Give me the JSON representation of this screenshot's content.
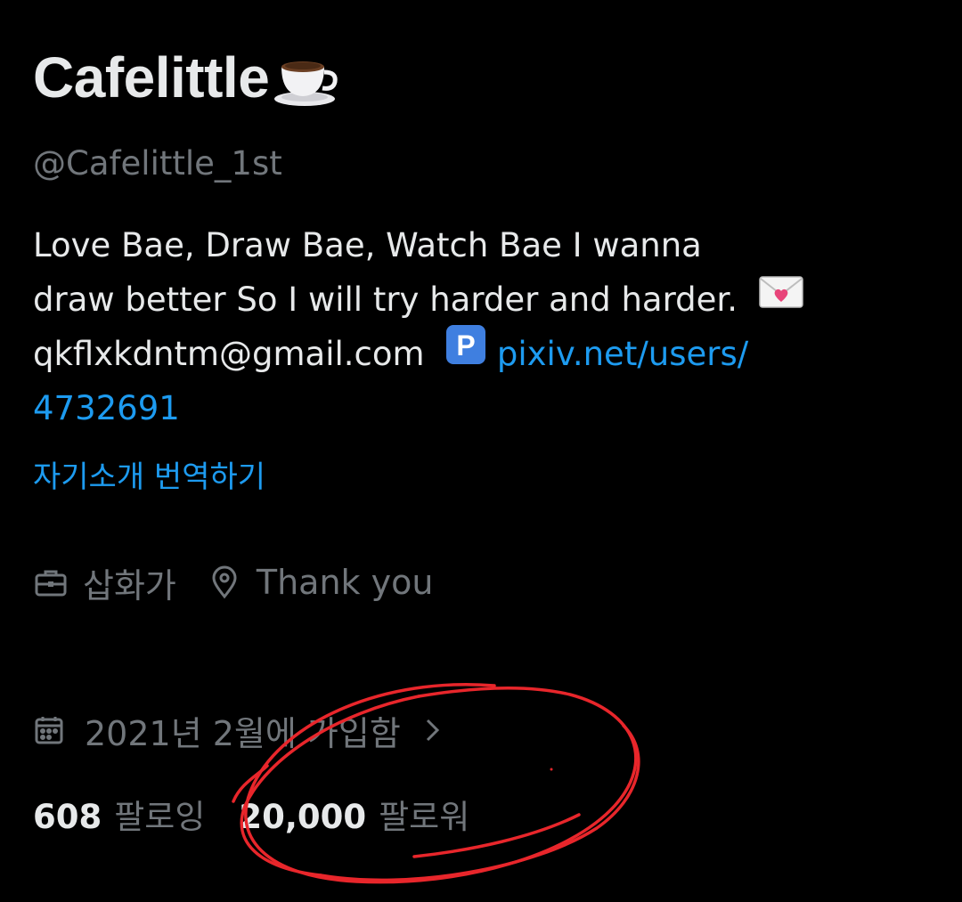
{
  "profile": {
    "display_name": "Cafelittle",
    "name_emoji_icon": "coffee-cup-icon",
    "handle": "@Cafelittle_1st",
    "bio_line1": "Love Bae, Draw Bae, Watch Bae  I wanna",
    "bio_line2": "draw better So I will try harder and harder.",
    "bio_email": "qkflxkdntm@gmail.com",
    "bio_link_part1": "pixiv.net/users/",
    "bio_link_part2": "4732691",
    "translate_bio": "자기소개 번역하기",
    "profession": "삽화가",
    "location": "Thank you",
    "joined": "2021년 2월에 가입함",
    "following_count": "608",
    "following_label": "팔로잉",
    "followers_count": "20,000",
    "followers_label": "팔로워"
  },
  "icons": {
    "envelope": "love-letter-icon",
    "parking": "p-button-icon",
    "briefcase": "briefcase-icon",
    "location": "location-pin-icon",
    "calendar": "calendar-icon",
    "chevron": "chevron-right-icon"
  },
  "colors": {
    "background": "#000000",
    "text_primary": "#e7e9ea",
    "text_secondary": "#71767b",
    "link": "#1d9bf0",
    "annotation": "#e8262b"
  }
}
